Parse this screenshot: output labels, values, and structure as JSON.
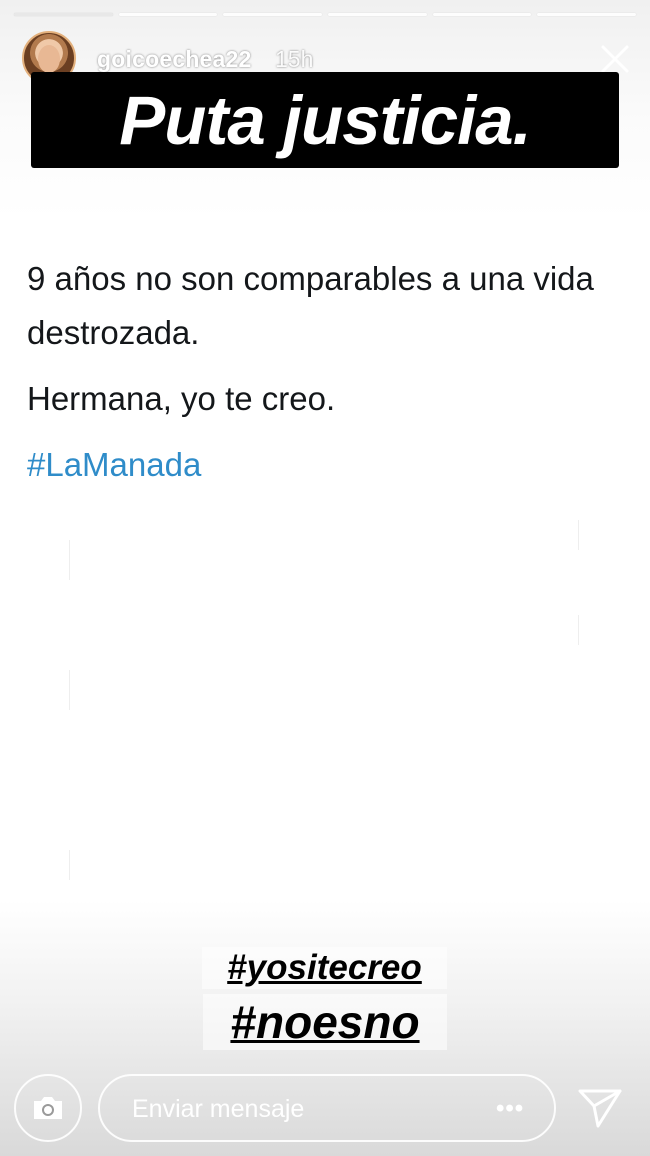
{
  "story": {
    "progress_segments": 6,
    "active_segment": 1,
    "username": "goicoechea22",
    "timestamp": "15h"
  },
  "headline": {
    "text": "Puta justicia."
  },
  "tweet": {
    "line1": "9 años no son comparables a una vida destrozada.",
    "line2": "Hermana, yo te creo.",
    "hashtag": "#LaManada",
    "hashtag_color": "#2f8cc9"
  },
  "stickers": [
    "#yositecreo",
    "#noesno"
  ],
  "reply_bar": {
    "placeholder": "Enviar mensaje",
    "more": "•••"
  },
  "icons": {
    "camera": "camera-icon",
    "close": "close-icon",
    "send": "send-icon",
    "more": "more-icon"
  }
}
